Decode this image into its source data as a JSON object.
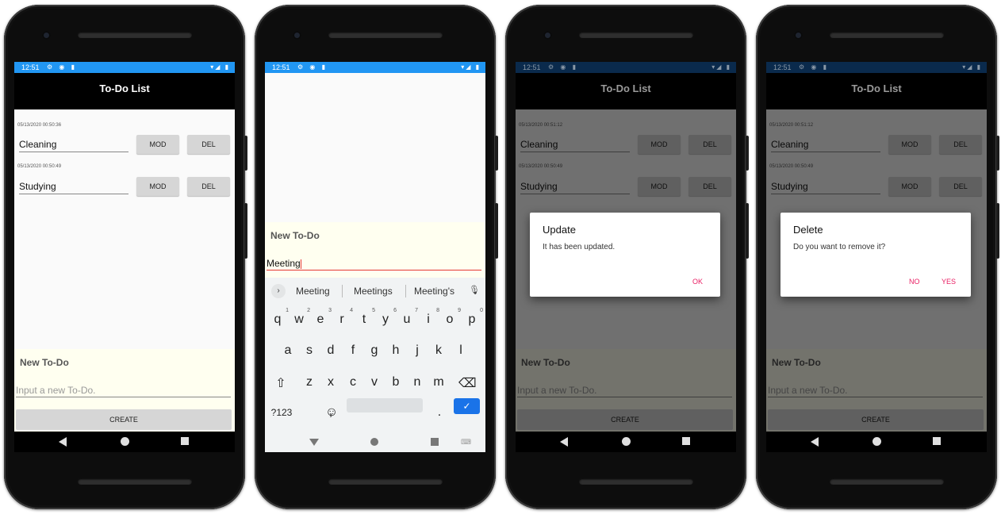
{
  "status": {
    "time": "12:51",
    "left_icons": "⚙ ◉ ▮",
    "right_icons": "▾◢ ▮"
  },
  "app": {
    "title": "To-Do List"
  },
  "screen1": {
    "todos": [
      {
        "timestamp": "05/13/2020 00:50:36",
        "text": "Cleaning"
      },
      {
        "timestamp": "05/13/2020 00:50:49",
        "text": "Studying"
      }
    ],
    "new_todo_title": "New To-Do",
    "input_placeholder": "Input a new To-Do.",
    "create_label": "CREATE"
  },
  "buttons": {
    "mod": "MOD",
    "del": "DEL"
  },
  "screen2": {
    "new_todo_title": "New To-Do",
    "input_value": "Meeting",
    "suggestions": [
      "Meeting",
      "Meetings",
      "Meeting's"
    ],
    "row1": [
      "q",
      "w",
      "e",
      "r",
      "t",
      "y",
      "u",
      "i",
      "o",
      "p"
    ],
    "row1_nums": [
      "1",
      "2",
      "3",
      "4",
      "5",
      "6",
      "7",
      "8",
      "9",
      "0"
    ],
    "row2": [
      "a",
      "s",
      "d",
      "f",
      "g",
      "h",
      "j",
      "k",
      "l"
    ],
    "row3": [
      "z",
      "x",
      "c",
      "v",
      "b",
      "n",
      "m"
    ],
    "shift": "⇧",
    "backspace": "⌫",
    "symbols": "?123",
    "comma": ",",
    "emoji": "☺",
    "period": ".",
    "enter": "✓",
    "suggest_arrow": "›",
    "mic": "🎙",
    "kb_icon": "⌨"
  },
  "screen3": {
    "todos": [
      {
        "timestamp": "05/13/2020 00:51:12",
        "text": "Cleaning"
      },
      {
        "timestamp": "05/13/2020 00:50:49",
        "text": "Studying"
      }
    ],
    "dialog": {
      "title": "Update",
      "message": "It has been updated.",
      "ok": "OK"
    },
    "new_todo_title": "New To-Do",
    "input_placeholder": "Input a new To-Do.",
    "create_label": "CREATE"
  },
  "screen4": {
    "todos": [
      {
        "timestamp": "05/13/2020 00:51:12",
        "text": "Cleaning"
      },
      {
        "timestamp": "05/13/2020 00:50:49",
        "text": "Studying"
      }
    ],
    "dialog": {
      "title": "Delete",
      "message": "Do you want to remove it?",
      "no": "NO",
      "yes": "YES"
    },
    "new_todo_title": "New To-Do",
    "input_placeholder": "Input a new To-Do.",
    "create_label": "CREATE"
  },
  "colors": {
    "statusbar": "#2196f3",
    "accent": "#e91e63",
    "enter_key": "#1a73e8"
  }
}
